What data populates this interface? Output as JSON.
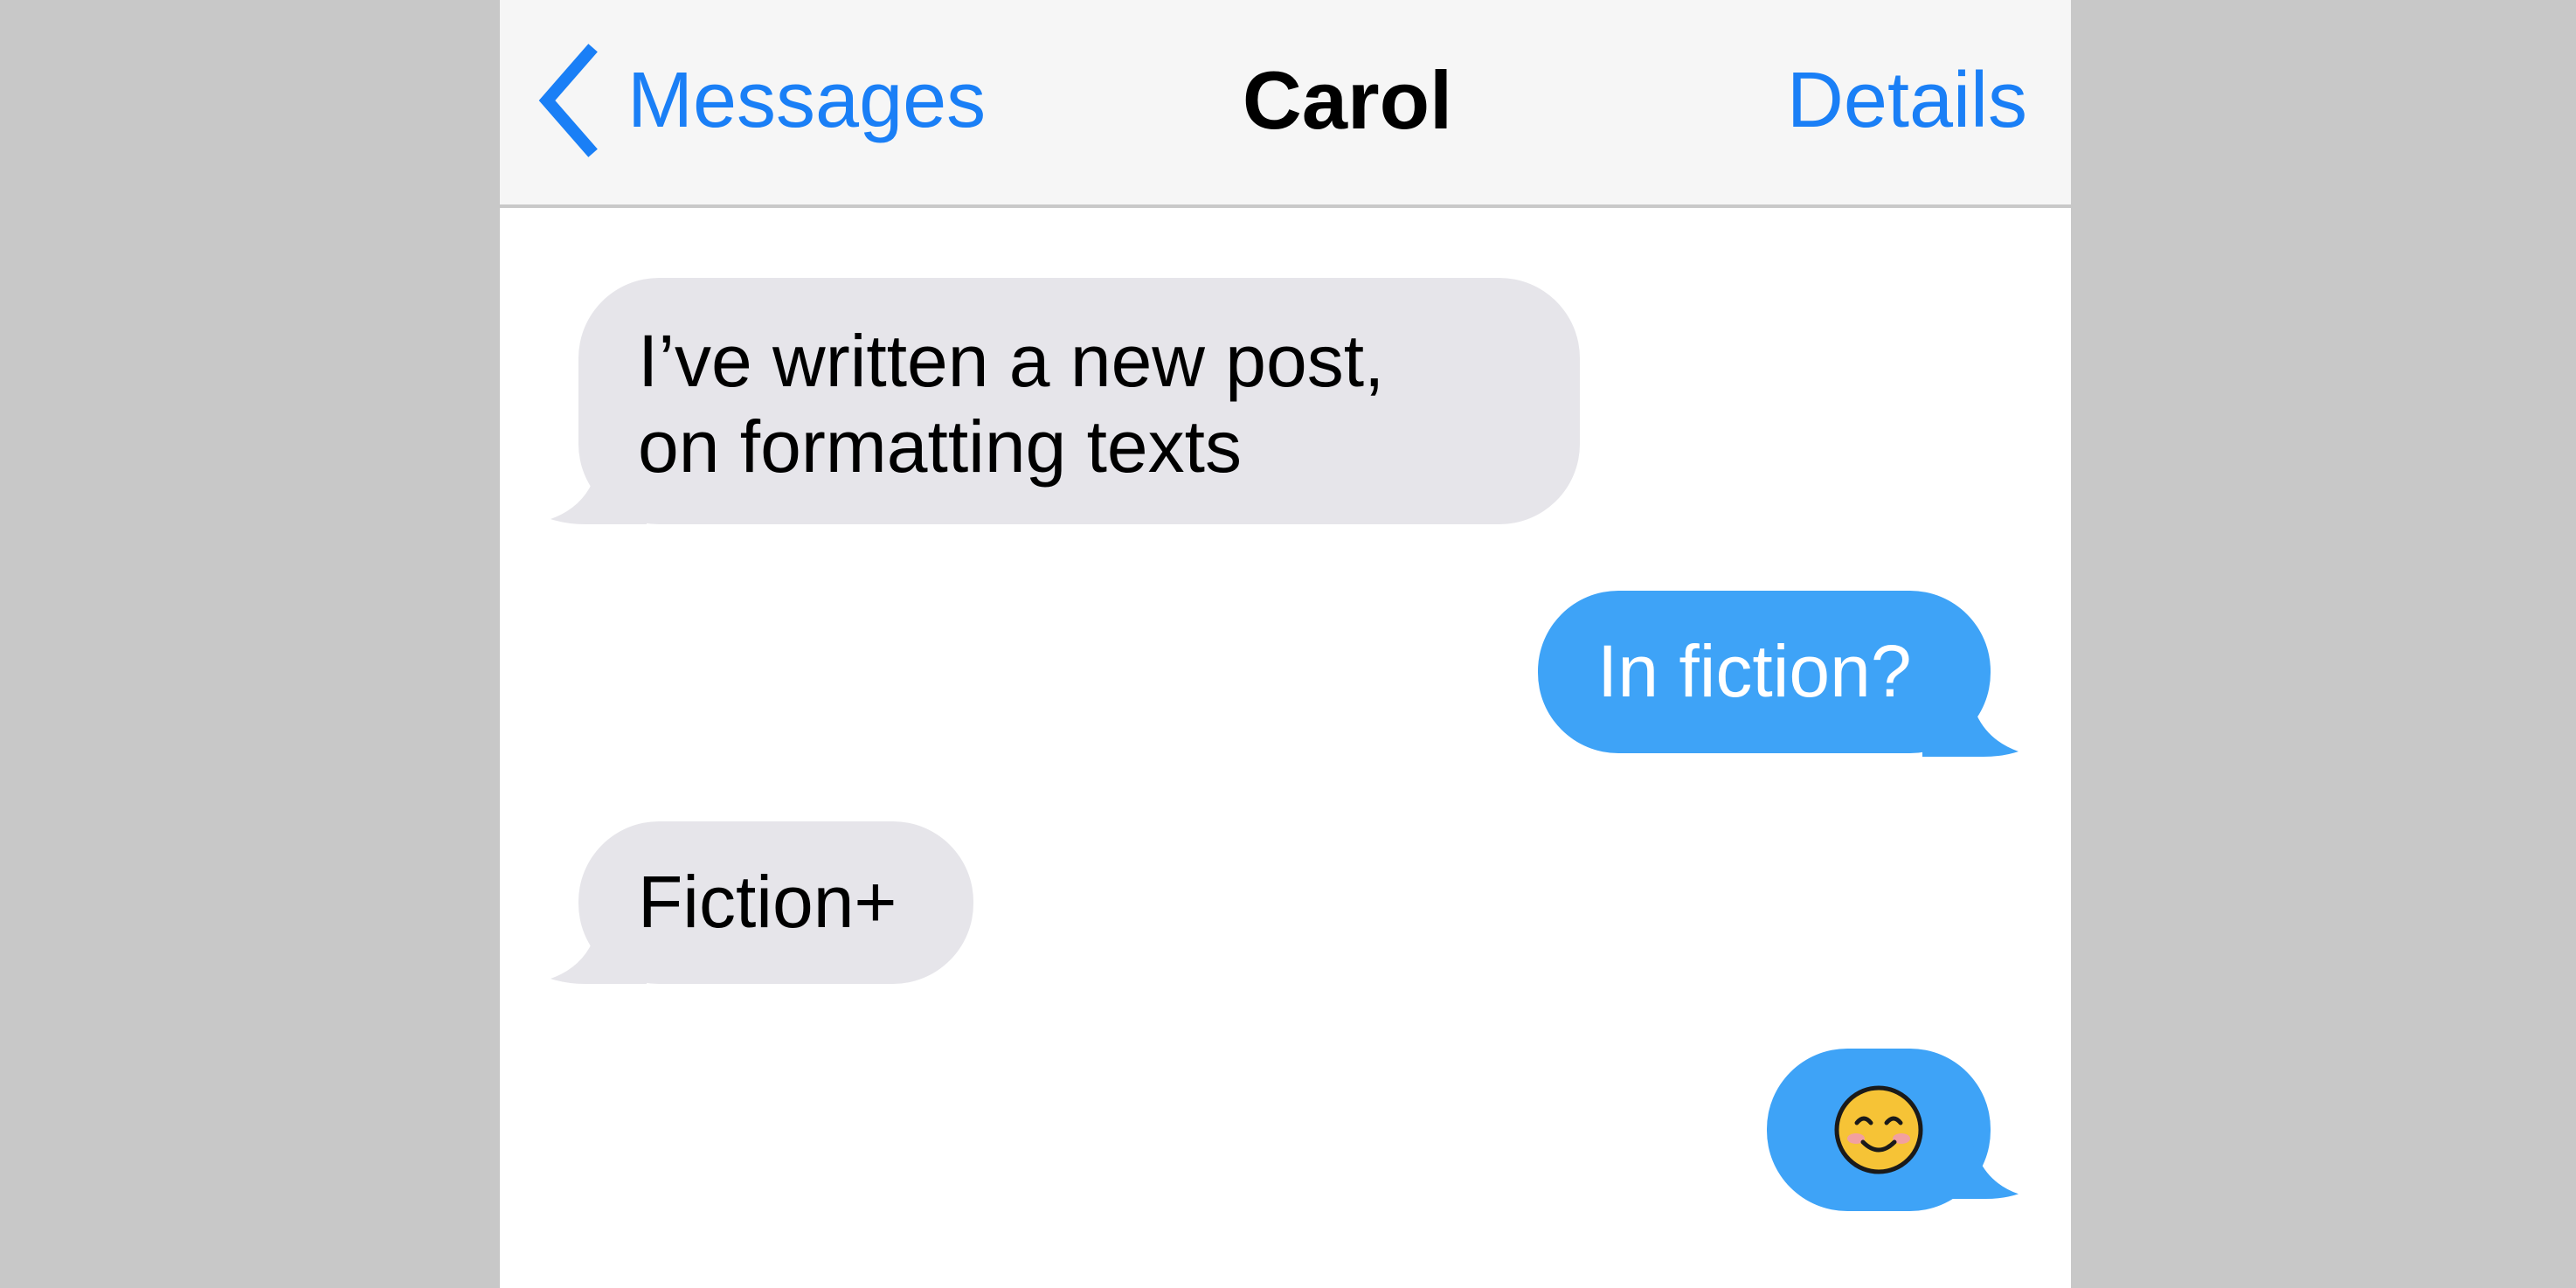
{
  "navbar": {
    "back_label": "Messages",
    "title": "Carol",
    "details_label": "Details"
  },
  "messages": [
    {
      "direction": "incoming",
      "lines": [
        "I’ve written a new post,",
        "on formatting texts"
      ]
    },
    {
      "direction": "outgoing",
      "lines": [
        "In fiction?"
      ]
    },
    {
      "direction": "incoming",
      "lines": [
        "Fiction+"
      ]
    },
    {
      "direction": "outgoing",
      "icon": "smiling-face-emoji-icon"
    }
  ],
  "colors": {
    "accent": "#1a7ff6",
    "incoming_bubble": "#e6e5ea",
    "outgoing_bubble": "#3ea3f7",
    "navbar_background": "#f6f6f6"
  }
}
